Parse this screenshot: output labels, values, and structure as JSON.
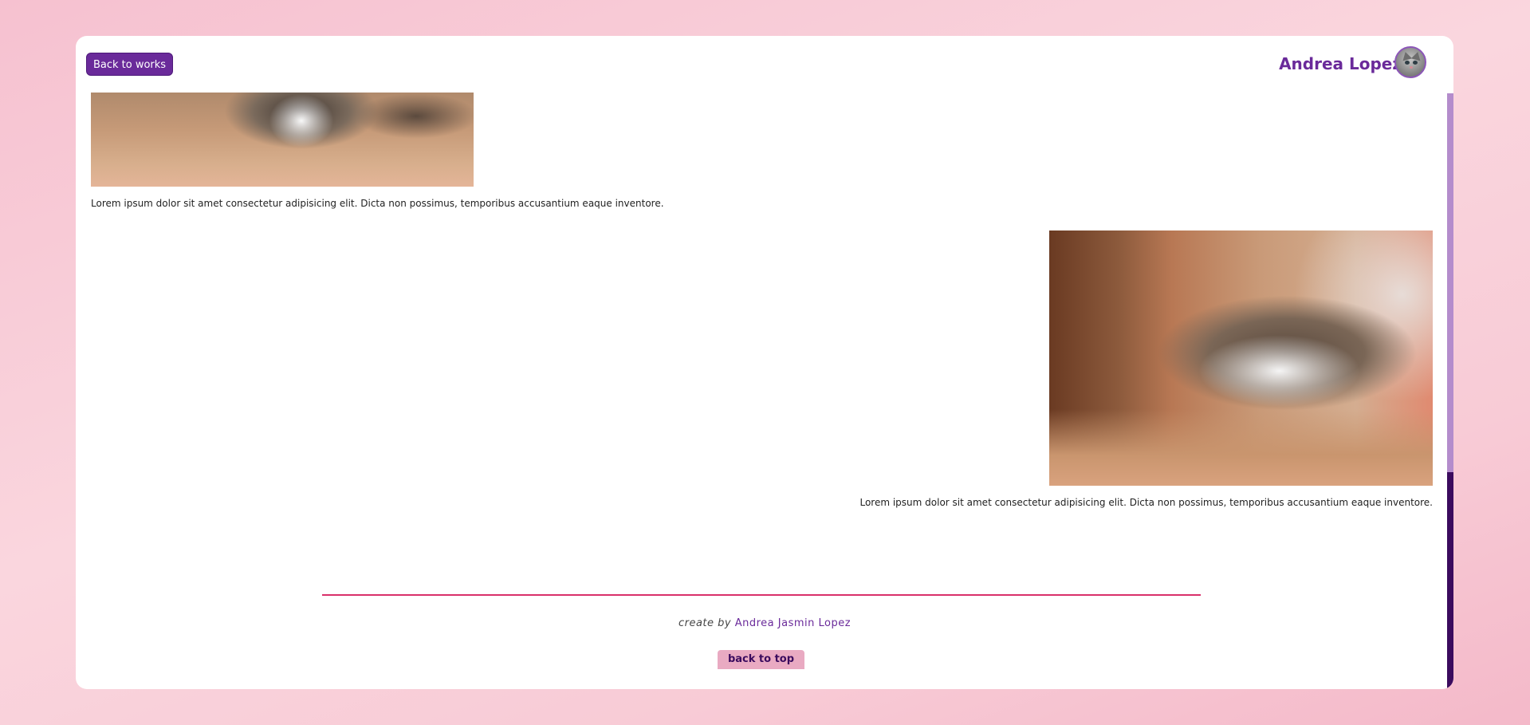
{
  "header": {
    "back_button_label": "Back to works",
    "author_name": "Andrea Lopez",
    "avatar_icon": "cat-avatar-icon"
  },
  "gallery": [
    {
      "image": "cat-photo",
      "caption": "Lorem ipsum dolor sit amet consectetur adipisicing elit. Dicta non possimus, temporibus accusantium eaque inventore."
    },
    {
      "image": "cat-photo",
      "caption": "Lorem ipsum dolor sit amet consectetur adipisicing elit. Dicta non possimus, temporibus accusantium eaque inventore."
    }
  ],
  "footer": {
    "credit_prefix": "create by",
    "credit_name": "Andrea Jasmin Lopez",
    "back_to_top_label": "back to top"
  },
  "colors": {
    "accent": "#6a2a9a",
    "divider": "#d9306a",
    "back_to_top_bg": "#e9aac2",
    "scrollbar_track": "#b48ccc",
    "scrollbar_thumb": "#3b0b5e"
  }
}
